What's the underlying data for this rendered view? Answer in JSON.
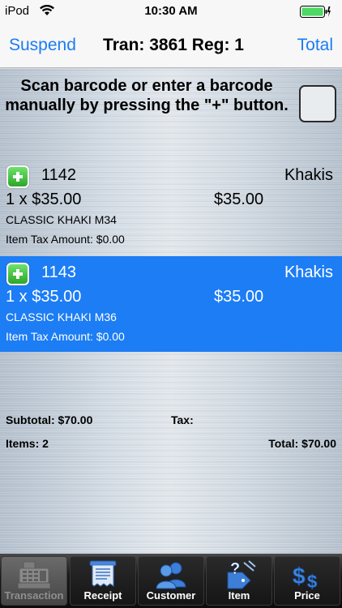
{
  "status_bar": {
    "carrier": "iPod",
    "time": "10:30 AM"
  },
  "nav": {
    "left_button": "Suspend",
    "title": "Tran: 3861 Reg: 1",
    "right_button": "Total",
    "accent_color": "#1b7cf2"
  },
  "instruction": "Scan barcode or enter a barcode manually by pressing the \"+\" button.",
  "items": [
    {
      "sku": "1142",
      "category": "Khakis",
      "qty_price": "1 x $35.00",
      "line_total": "$35.00",
      "description": "CLASSIC KHAKI M34",
      "tax": "Item Tax Amount: $0.00",
      "selected": false
    },
    {
      "sku": "1143",
      "category": "Khakis",
      "qty_price": "1 x $35.00",
      "line_total": "$35.00",
      "description": "CLASSIC KHAKI M36",
      "tax": "Item Tax Amount: $0.00",
      "selected": true
    }
  ],
  "summary": {
    "subtotal": "Subtotal: $70.00",
    "tax": "Tax:",
    "items": "Items: 2",
    "total": "Total: $70.00"
  },
  "tabs": [
    {
      "label": "Transaction",
      "icon": "cash-register-icon",
      "active": true
    },
    {
      "label": "Receipt",
      "icon": "receipt-icon",
      "active": false
    },
    {
      "label": "Customer",
      "icon": "customers-icon",
      "active": false
    },
    {
      "label": "Item",
      "icon": "item-tag-icon",
      "active": false
    },
    {
      "label": "Price",
      "icon": "price-icon",
      "active": false
    }
  ],
  "colors": {
    "selected_row": "#1c7df5",
    "tab_bar": "#111111"
  }
}
